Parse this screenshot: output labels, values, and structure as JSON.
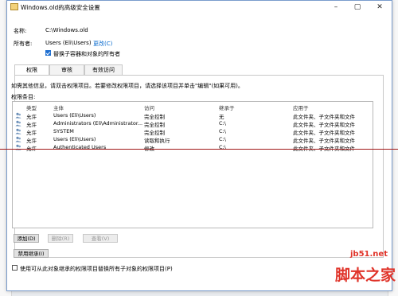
{
  "window": {
    "title": "Windows.old的高级安全设置"
  },
  "name_label": "名称:",
  "name_value": "C:\\Windows.old",
  "owner_label": "所有者:",
  "owner_value": "Users (Eli\\Users)",
  "owner_change_link": "更改(C)",
  "replace_owner_checkbox": {
    "label": "替换子容器和对象的所有者",
    "checked": true
  },
  "tabs": [
    {
      "label": "权限",
      "active": true
    },
    {
      "label": "审核",
      "active": false
    },
    {
      "label": "有效访问",
      "active": false
    }
  ],
  "info_text": "如需其他信息，请双击权限项目。若要修改权限项目，请选择该项目并单击\"编辑\"(如果可用)。",
  "entries_label": "权限条目:",
  "columns": [
    "类型",
    "主体",
    "访问",
    "继承于",
    "应用于"
  ],
  "rows": [
    {
      "type": "允许",
      "principal": "Users (Eli\\Users)",
      "access": "完全控制",
      "inherited": "无",
      "applies": "此文件夹、子文件夹和文件"
    },
    {
      "type": "允许",
      "principal": "Administrators (Eli\\Administrator...",
      "access": "完全控制",
      "inherited": "C:\\",
      "applies": "此文件夹、子文件夹和文件"
    },
    {
      "type": "允许",
      "principal": "SYSTEM",
      "access": "完全控制",
      "inherited": "C:\\",
      "applies": "此文件夹、子文件夹和文件"
    },
    {
      "type": "允许",
      "principal": "Users (Eli\\Users)",
      "access": "读取和执行",
      "inherited": "C:\\",
      "applies": "此文件夹、子文件夹和文件"
    },
    {
      "type": "允许",
      "principal": "Authenticated Users",
      "access": "修改",
      "inherited": "C:\\",
      "applies": "此文件夹、子文件夹和文件"
    }
  ],
  "buttons": {
    "add": "添加(D)",
    "remove": "删除(R)",
    "view": "查看(V)",
    "disable_inheritance": "禁用继承(I)"
  },
  "replace_child_checkbox": {
    "label": "使用可从此对象继承的权限项目替换所有子对象的权限项目(P)",
    "checked": false
  },
  "watermark": {
    "site": "jb51.net",
    "brand": "脚本之家"
  },
  "colors": {
    "accent": "#1e6fd1",
    "link": "#0066cc",
    "redline": "#a01818",
    "watermark": "#e0342a"
  }
}
